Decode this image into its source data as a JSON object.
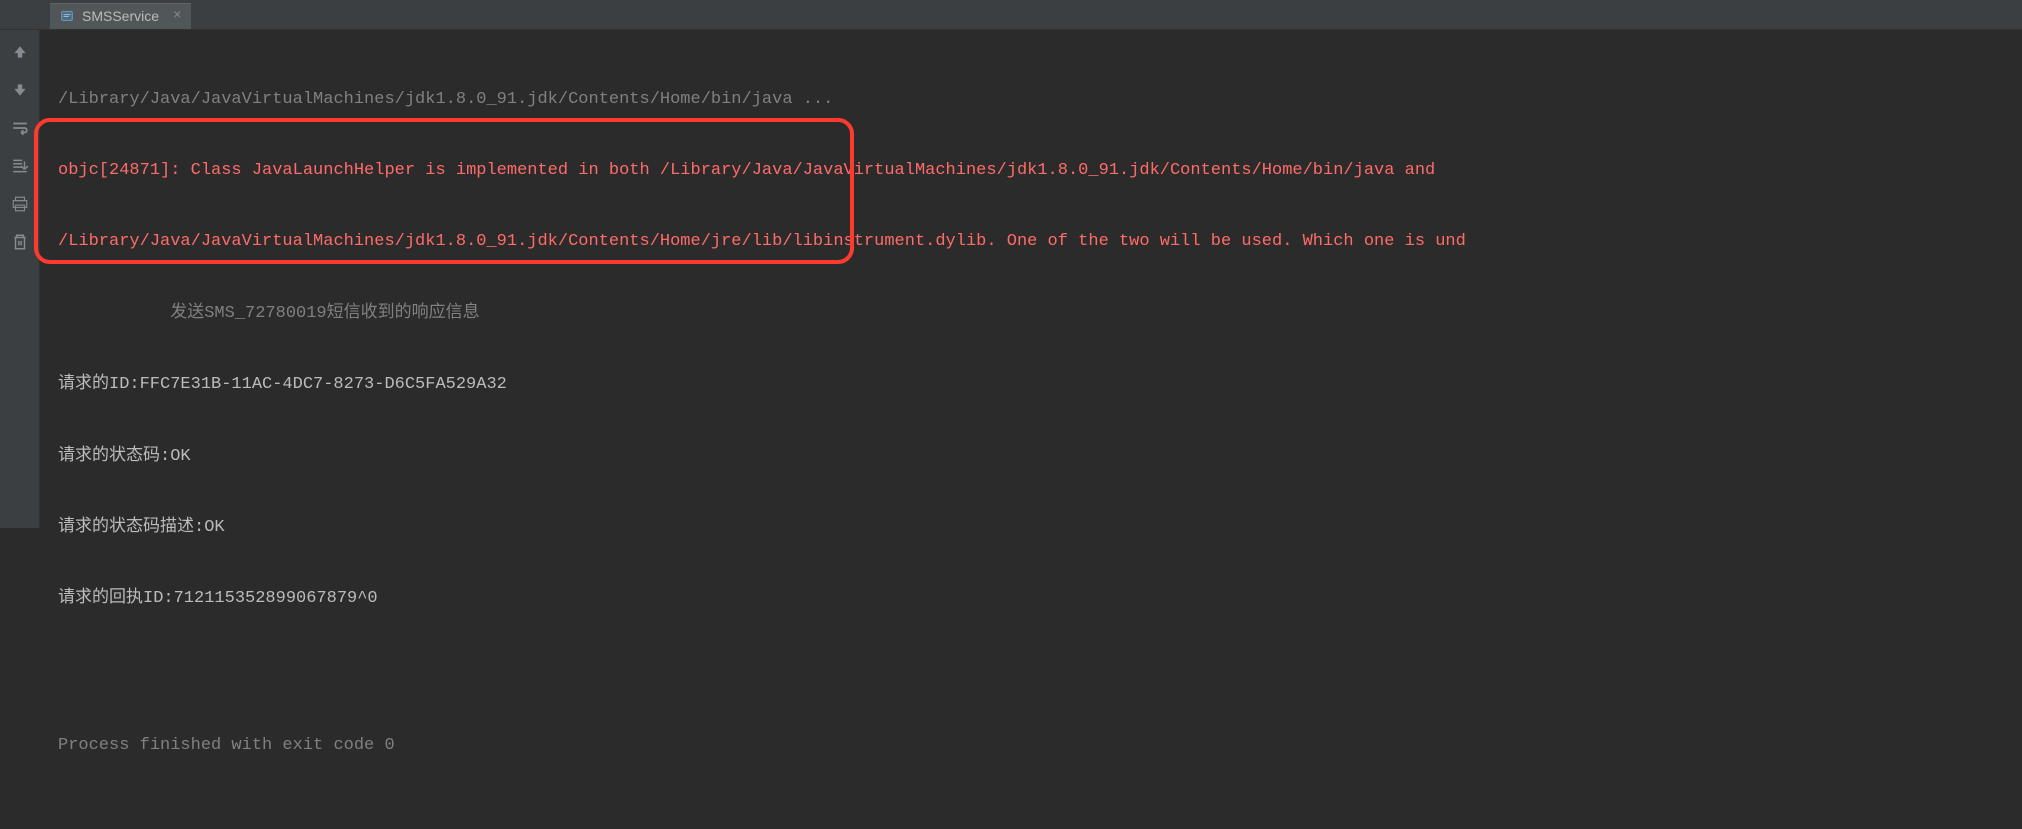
{
  "tab": {
    "label": "SMSService",
    "icon": "run-config-icon"
  },
  "console": {
    "line_java_path": "/Library/Java/JavaVirtualMachines/jdk1.8.0_91.jdk/Contents/Home/bin/java ...",
    "line_error_1": "objc[24871]: Class JavaLaunchHelper is implemented in both /Library/Java/JavaVirtualMachines/jdk1.8.0_91.jdk/Contents/Home/bin/java and ",
    "line_error_2": "/Library/Java/JavaVirtualMachines/jdk1.8.0_91.jdk/Contents/Home/jre/lib/libinstrument.dylib. One of the two will be used. Which one is und",
    "line_send_sms": "           发送SMS_72780019短信收到的响应信息",
    "line_request_id": "请求的ID:FFC7E31B-11AC-4DC7-8273-D6C5FA529A32",
    "line_status_code": "请求的状态码:OK",
    "line_status_desc": "请求的状态码描述:OK",
    "line_receipt_id": "请求的回执ID:712115352899067879^0",
    "line_exit": "Process finished with exit code 0"
  },
  "gutter": {
    "up": "arrow-up-icon",
    "down": "arrow-down-icon",
    "wrap": "soft-wrap-icon",
    "scroll": "scroll-to-end-icon",
    "print": "print-icon",
    "trash": "trash-icon"
  }
}
